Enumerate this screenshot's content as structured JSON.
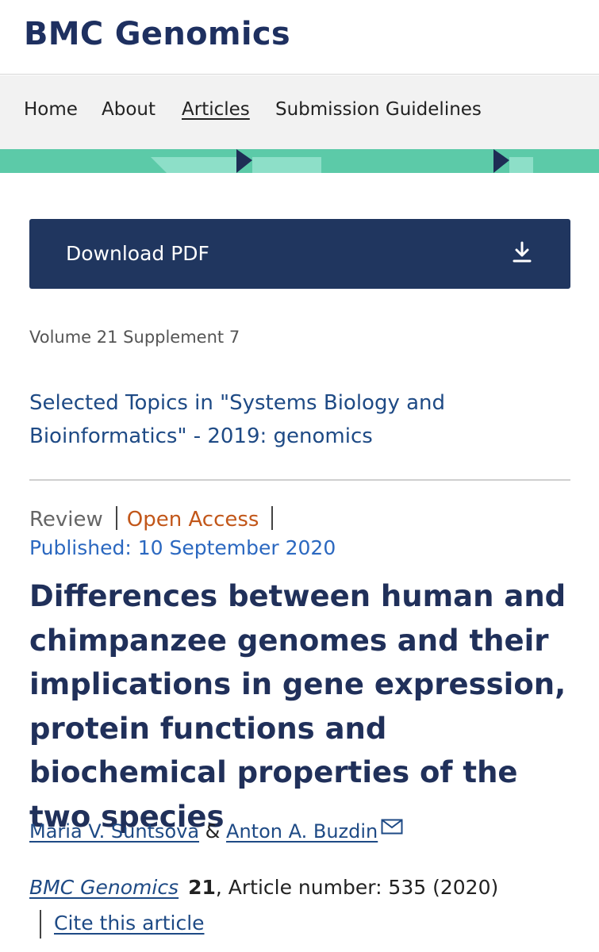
{
  "header": {
    "title": "BMC Genomics"
  },
  "nav": {
    "items": [
      {
        "label": "Home",
        "active": false
      },
      {
        "label": "About",
        "active": false
      },
      {
        "label": "Articles",
        "active": true
      },
      {
        "label": "Submission Guidelines",
        "active": false
      }
    ]
  },
  "download": {
    "label": "Download PDF",
    "icon": "download-icon"
  },
  "volume": "Volume 21 Supplement 7",
  "collection": {
    "title": "Selected Topics in \"Systems Biology and Bioinformatics\" - 2019: genomics"
  },
  "article": {
    "type": "Review",
    "access": "Open Access",
    "published": "Published: 10 September 2020",
    "title": "Differences between human and chimpanzee genomes and their implications in gene expression, protein functions and biochemical properties of the two species",
    "authors": [
      {
        "name": "Maria V. Suntsova"
      },
      {
        "name": "Anton A. Buzdin",
        "icon": "mail-icon"
      }
    ],
    "author_joiner": "&",
    "citation": {
      "journal": "BMC Genomics",
      "volume": "21",
      "details": ", Article number: 535 (2020)"
    },
    "cite_label": "Cite this article"
  },
  "colors": {
    "brand_navy": "#20365f",
    "title_navy": "#20305a",
    "stripe_teal": "#5ccaa8",
    "link_blue": "#1e4a85",
    "published_blue": "#2b68c0",
    "open_access_orange": "#c2571a"
  }
}
